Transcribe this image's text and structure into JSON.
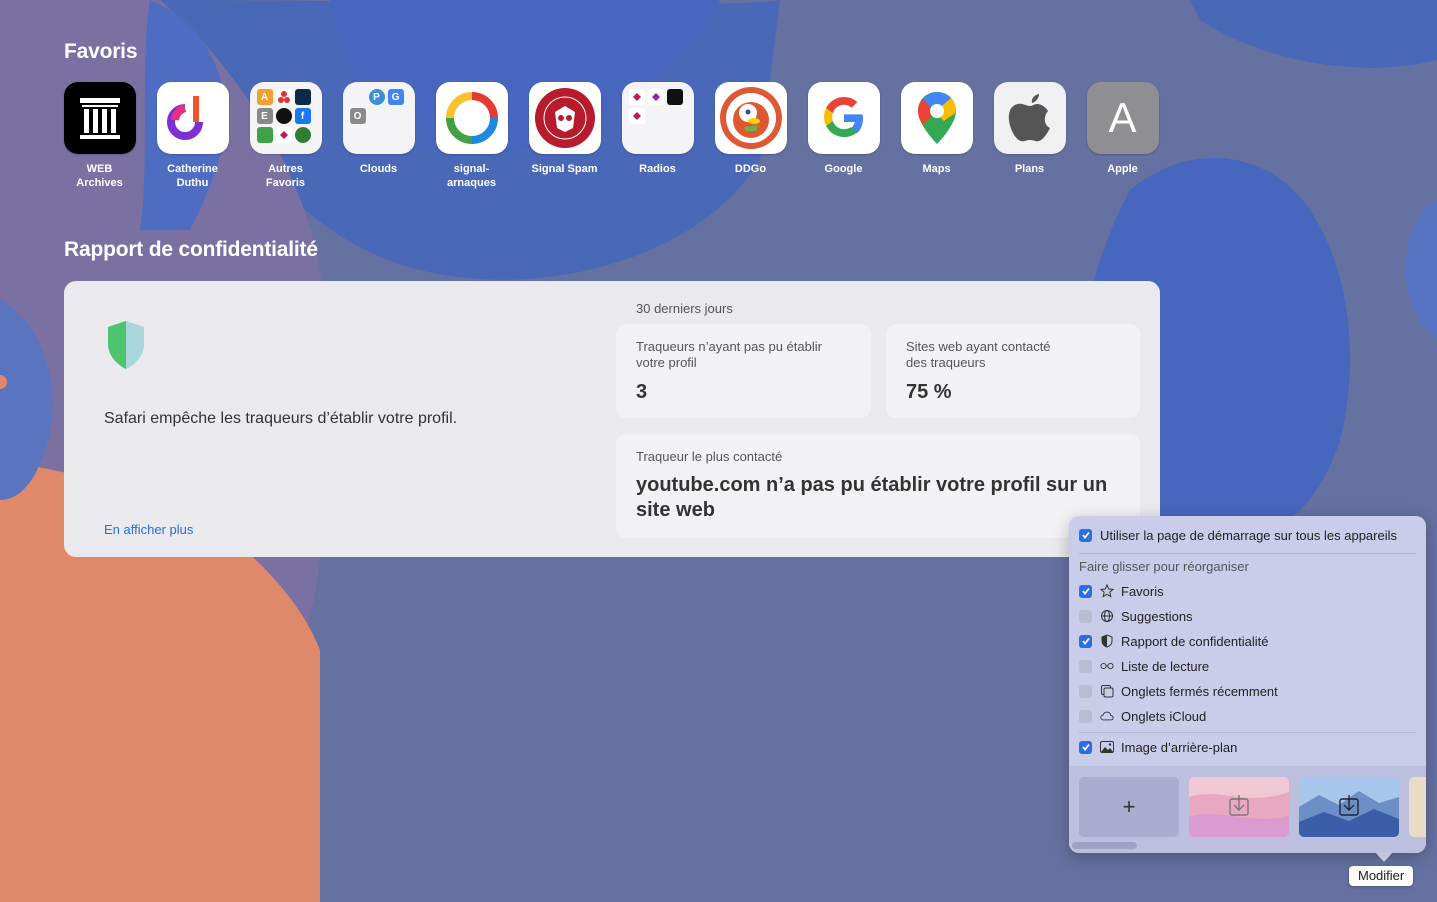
{
  "favorites": {
    "title": "Favoris",
    "items": [
      {
        "label": "WEB\nArchives",
        "icon": "internet-archive-icon"
      },
      {
        "label": "Catherine\nDuthu",
        "icon": "catherine-duthu-icon"
      },
      {
        "label": "Autres\nFavoris",
        "icon": "folder-icon",
        "minis": [
          "A",
          "E"
        ]
      },
      {
        "label": "Clouds",
        "icon": "folder-icon",
        "minis": [
          "P",
          "G",
          "O"
        ]
      },
      {
        "label": "signal-\narnaques",
        "icon": "signal-arnaques-icon"
      },
      {
        "label": "Signal Spam",
        "icon": "signal-spam-icon"
      },
      {
        "label": "Radios",
        "icon": "folder-icon"
      },
      {
        "label": "DDGo",
        "icon": "duckduckgo-icon"
      },
      {
        "label": "Google",
        "icon": "google-icon",
        "letter": "G"
      },
      {
        "label": "Maps",
        "icon": "google-maps-icon"
      },
      {
        "label": "Plans",
        "icon": "apple-icon"
      },
      {
        "label": "Apple",
        "icon": "apple-letter-icon",
        "letter": "A"
      }
    ]
  },
  "privacy": {
    "title": "Rapport de confidentialité",
    "description": "Safari empêche les traqueurs d’établir votre profil.",
    "more_link": "En afficher plus",
    "period": "30 derniers jours",
    "trackers_blocked_label": "Traqueurs n’ayant pas pu établir\nvotre profil",
    "trackers_blocked_value": "3",
    "sites_label": "Sites web ayant contacté\ndes traqueurs",
    "sites_value": "75 %",
    "top_tracker_label": "Traqueur le plus contacté",
    "top_tracker_value": "youtube.com n’a pas pu établir votre profil sur un site web"
  },
  "popover": {
    "sync_label": "Utiliser la page de démarrage sur tous les appareils",
    "sync_checked": true,
    "reorder_label": "Faire glisser pour réorganiser",
    "sections": [
      {
        "label": "Favoris",
        "checked": true,
        "icon": "star-icon"
      },
      {
        "label": "Suggestions",
        "checked": false,
        "icon": "globe-icon"
      },
      {
        "label": "Rapport de confidentialité",
        "checked": true,
        "icon": "shield-icon"
      },
      {
        "label": "Liste de lecture",
        "checked": false,
        "icon": "glasses-icon"
      },
      {
        "label": "Onglets fermés récemment",
        "checked": false,
        "icon": "tabs-icon"
      },
      {
        "label": "Onglets iCloud",
        "checked": false,
        "icon": "cloud-icon"
      }
    ],
    "background_label": "Image d’arrière-plan",
    "background_checked": true,
    "add_symbol": "+"
  },
  "tooltip": "Modifier",
  "colors": {
    "accent": "#2b6fe0",
    "link": "#2a6fd6",
    "background": "#6571a0"
  }
}
